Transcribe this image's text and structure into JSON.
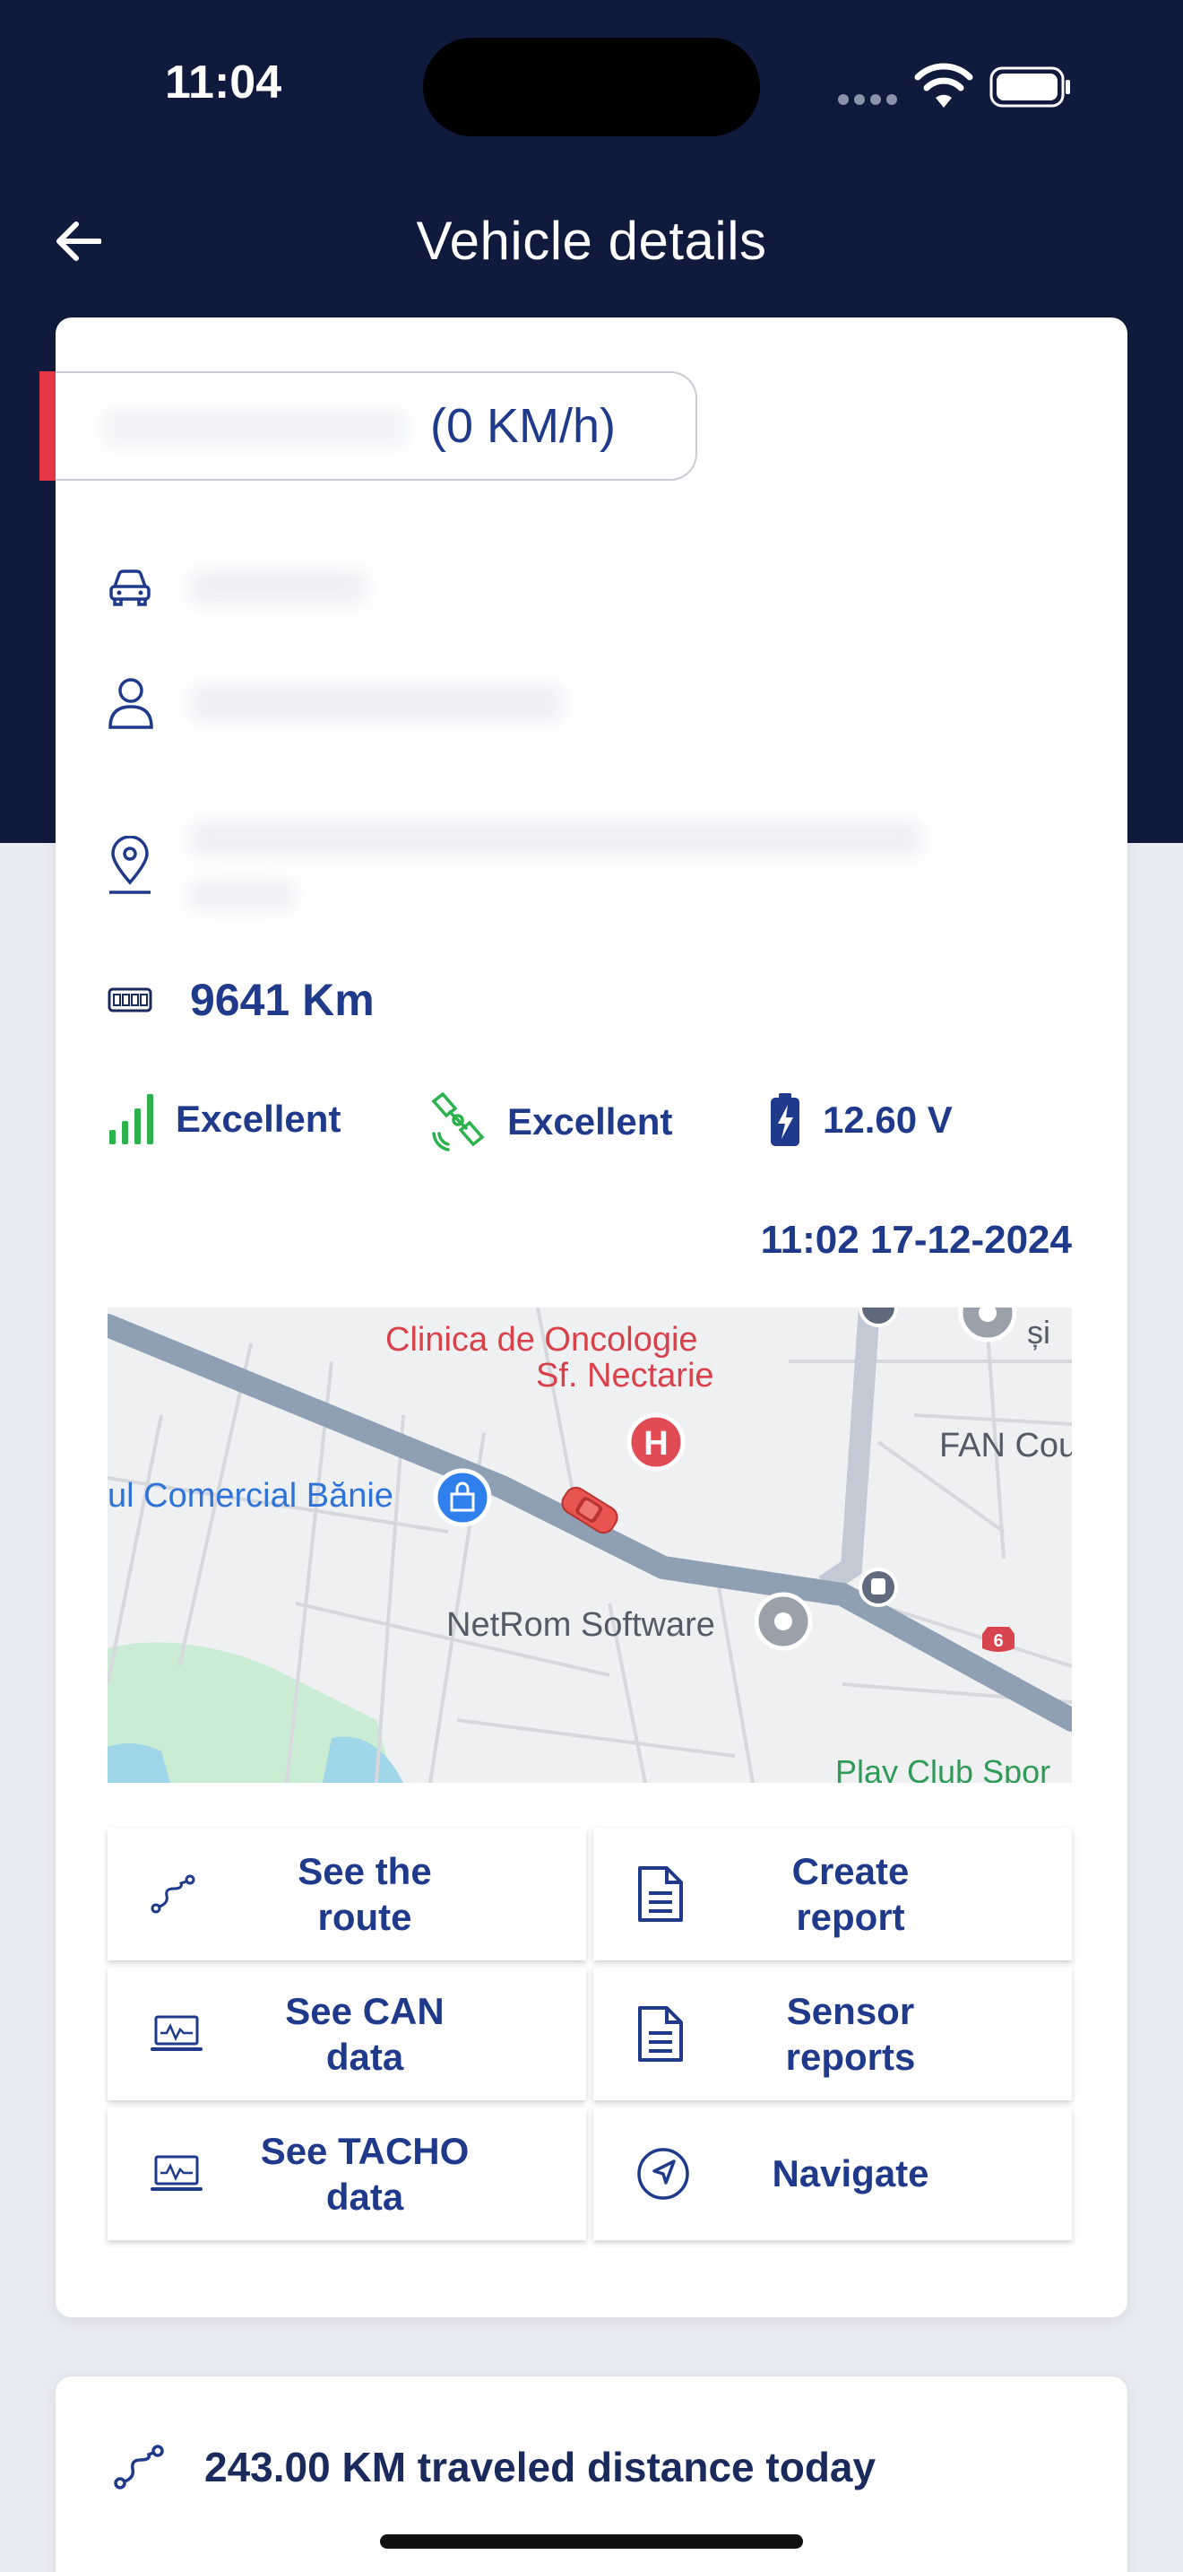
{
  "status_bar": {
    "time": "11:04"
  },
  "app_bar": {
    "title": "Vehicle details"
  },
  "vehicle": {
    "speed_text": "(0 KM/h)",
    "odometer": "9641 Km",
    "gsm_signal": "Excellent",
    "gps_signal": "Excellent",
    "battery_voltage": "12.60 V",
    "last_update": "11:02 17-12-2024"
  },
  "map": {
    "labels": {
      "poi_hospital": "Clinica de Oncologie",
      "poi_hospital_2": "Sf. Nectarie",
      "poi_mall": "ul Comercial Bănie",
      "poi_netrom": "NetRom Software",
      "poi_fan": "FAN Cou",
      "poi_si": "și",
      "poi_play": "Play Club Spor",
      "road_number": "6"
    }
  },
  "actions": [
    {
      "label": "See the route",
      "icon": "route-icon"
    },
    {
      "label": "Create report",
      "icon": "document-icon"
    },
    {
      "label": "See CAN data",
      "icon": "laptop-chart-icon"
    },
    {
      "label": "Sensor reports",
      "icon": "document-icon"
    },
    {
      "label": "See TACHO data",
      "icon": "laptop-chart-icon"
    },
    {
      "label": "Navigate",
      "icon": "navigation-icon"
    }
  ],
  "summary": {
    "distance_today": "243.00 KM traveled distance today"
  },
  "colors": {
    "header": "#0f1a3c",
    "accent": "#1f3a8a",
    "status_green": "#2bb24c",
    "alert_red": "#e53646"
  }
}
